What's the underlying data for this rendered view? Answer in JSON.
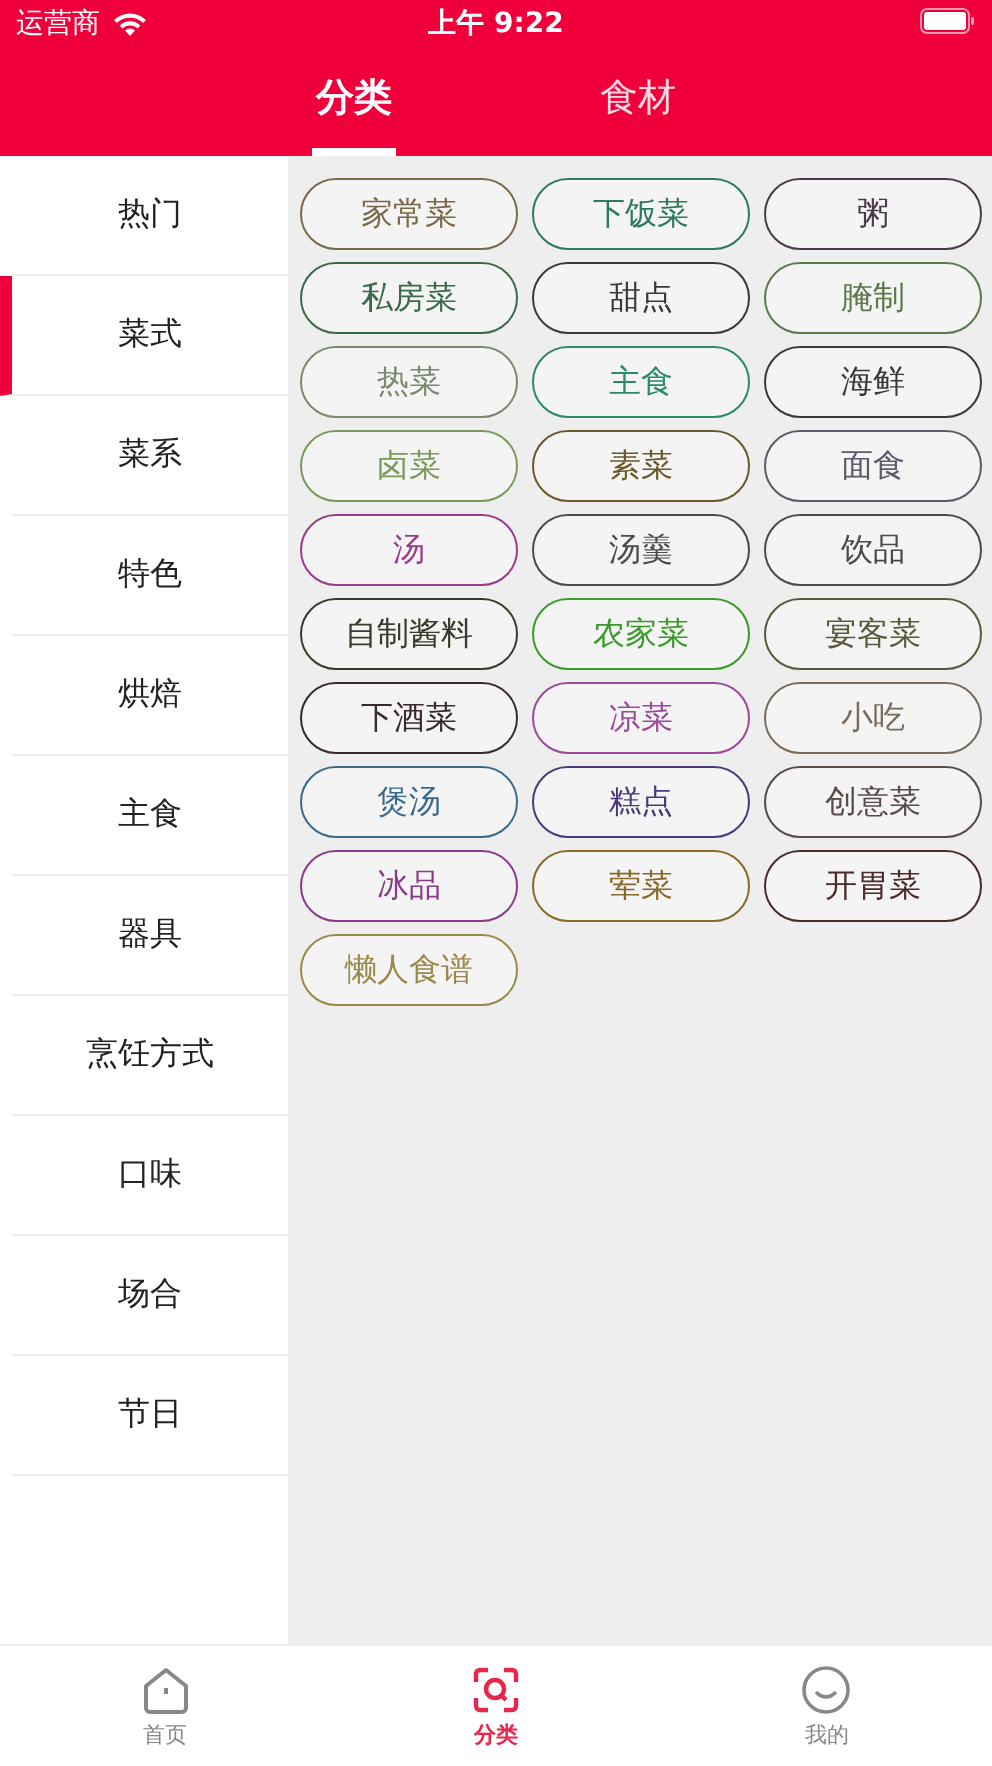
{
  "status_bar": {
    "carrier": "运营商",
    "time": "上午 9:22"
  },
  "tabs": [
    {
      "label": "分类",
      "selected": true
    },
    {
      "label": "食材",
      "selected": false
    }
  ],
  "sidebar": {
    "items": [
      {
        "label": "热门",
        "selected": false
      },
      {
        "label": "菜式",
        "selected": true
      },
      {
        "label": "菜系",
        "selected": false
      },
      {
        "label": "特色",
        "selected": false
      },
      {
        "label": "烘焙",
        "selected": false
      },
      {
        "label": "主食",
        "selected": false
      },
      {
        "label": "器具",
        "selected": false
      },
      {
        "label": "烹饪方式",
        "selected": false
      },
      {
        "label": "口味",
        "selected": false
      },
      {
        "label": "场合",
        "selected": false
      },
      {
        "label": "节日",
        "selected": false
      }
    ]
  },
  "tags": [
    {
      "label": "家常菜",
      "color": "#7a6a4a"
    },
    {
      "label": "下饭菜",
      "color": "#2f7a5a"
    },
    {
      "label": "粥",
      "color": "#4a3a4a"
    },
    {
      "label": "私房菜",
      "color": "#3a6a4a"
    },
    {
      "label": "甜点",
      "color": "#3a3a3a"
    },
    {
      "label": "腌制",
      "color": "#5a7a4a"
    },
    {
      "label": "热菜",
      "color": "#7a8a6a"
    },
    {
      "label": "主食",
      "color": "#2a8a6a"
    },
    {
      "label": "海鲜",
      "color": "#3a3a3a"
    },
    {
      "label": "卤菜",
      "color": "#7a9a5a"
    },
    {
      "label": "素菜",
      "color": "#6a5a2a"
    },
    {
      "label": "面食",
      "color": "#5a5a6a"
    },
    {
      "label": "汤",
      "color": "#9a3a8a"
    },
    {
      "label": "汤羹",
      "color": "#4a4a4a"
    },
    {
      "label": "饮品",
      "color": "#4a4a4a"
    },
    {
      "label": "自制酱料",
      "color": "#3a3a2a"
    },
    {
      "label": "农家菜",
      "color": "#3a9a2a"
    },
    {
      "label": "宴客菜",
      "color": "#5a5a3a"
    },
    {
      "label": "下酒菜",
      "color": "#3a2a2a"
    },
    {
      "label": "凉菜",
      "color": "#9a4a9a"
    },
    {
      "label": "小吃",
      "color": "#7a6a5a"
    },
    {
      "label": "煲汤",
      "color": "#3a6a8a"
    },
    {
      "label": "糕点",
      "color": "#4a3a7a"
    },
    {
      "label": "创意菜",
      "color": "#5a4a4a"
    },
    {
      "label": "冰品",
      "color": "#8a3a8a"
    },
    {
      "label": "荤菜",
      "color": "#8a6a2a"
    },
    {
      "label": "开胃菜",
      "color": "#4a2a2a"
    },
    {
      "label": "懒人食谱",
      "color": "#9a8a4a"
    }
  ],
  "tab_bar": [
    {
      "kind": "home",
      "label": "首页",
      "selected": false
    },
    {
      "kind": "category",
      "label": "分类",
      "selected": true
    },
    {
      "kind": "profile",
      "label": "我的",
      "selected": false
    }
  ]
}
